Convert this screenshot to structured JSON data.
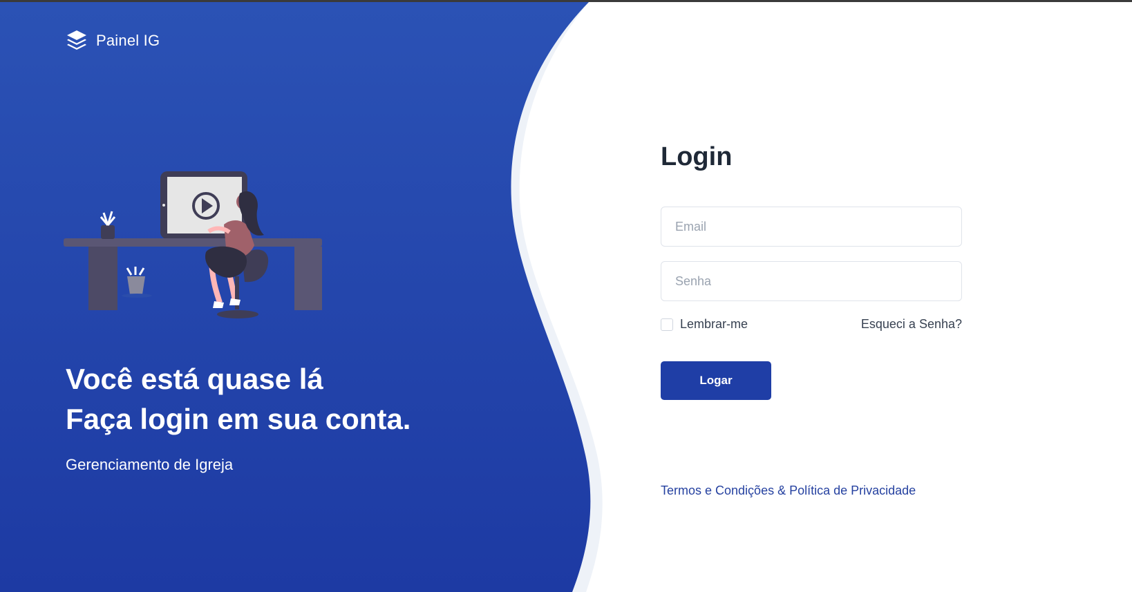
{
  "brand": {
    "name": "Painel IG",
    "icon": "layers-icon"
  },
  "hero": {
    "line1": "Você está quase lá",
    "line2": "Faça login em sua conta.",
    "subtitle": "Gerenciamento de Igreja"
  },
  "login": {
    "title": "Login",
    "email_placeholder": "Email",
    "password_placeholder": "Senha",
    "remember_label": "Lembrar-me",
    "forgot_label": "Esqueci a Senha?",
    "submit_label": "Logar",
    "terms_label": "Termos e Condições & Política de Privacidade"
  },
  "colors": {
    "primary": "#1f3ea6",
    "panel_top": "#2b52b5",
    "panel_bottom": "#1d3aa3",
    "heading": "#1f2937"
  }
}
